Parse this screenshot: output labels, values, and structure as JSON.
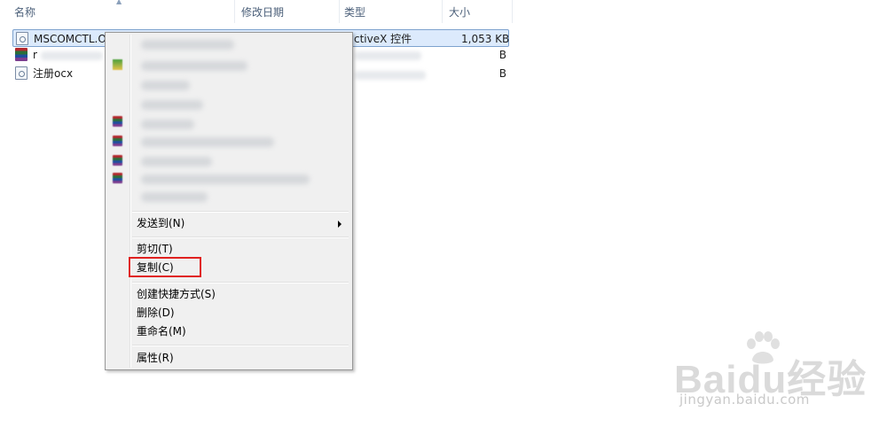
{
  "columns": {
    "name": "名称",
    "date": "修改日期",
    "type": "类型",
    "size": "大小"
  },
  "files": [
    {
      "name": "MSCOMCTL.O",
      "type": "ctiveX 控件",
      "size": "1,053 KB",
      "icon": "ocx-file-icon",
      "selected": true
    },
    {
      "name": "r",
      "type": "",
      "size": "B",
      "icon": "rar-archive-icon"
    },
    {
      "name": "注册ocx",
      "type": "",
      "size": "B",
      "icon": "ocx-file-icon"
    }
  ],
  "context_menu": {
    "send_to": "发送到(N)",
    "cut": "剪切(T)",
    "copy": "复制(C)",
    "create_shortcut": "创建快捷方式(S)",
    "delete": "删除(D)",
    "rename": "重命名(M)",
    "properties": "属性(R)"
  },
  "watermark": {
    "brand": "Baidu经验",
    "url": "jingyan.baidu.com"
  },
  "colors": {
    "highlight": "#e0211f",
    "selection": "#dceafc"
  }
}
